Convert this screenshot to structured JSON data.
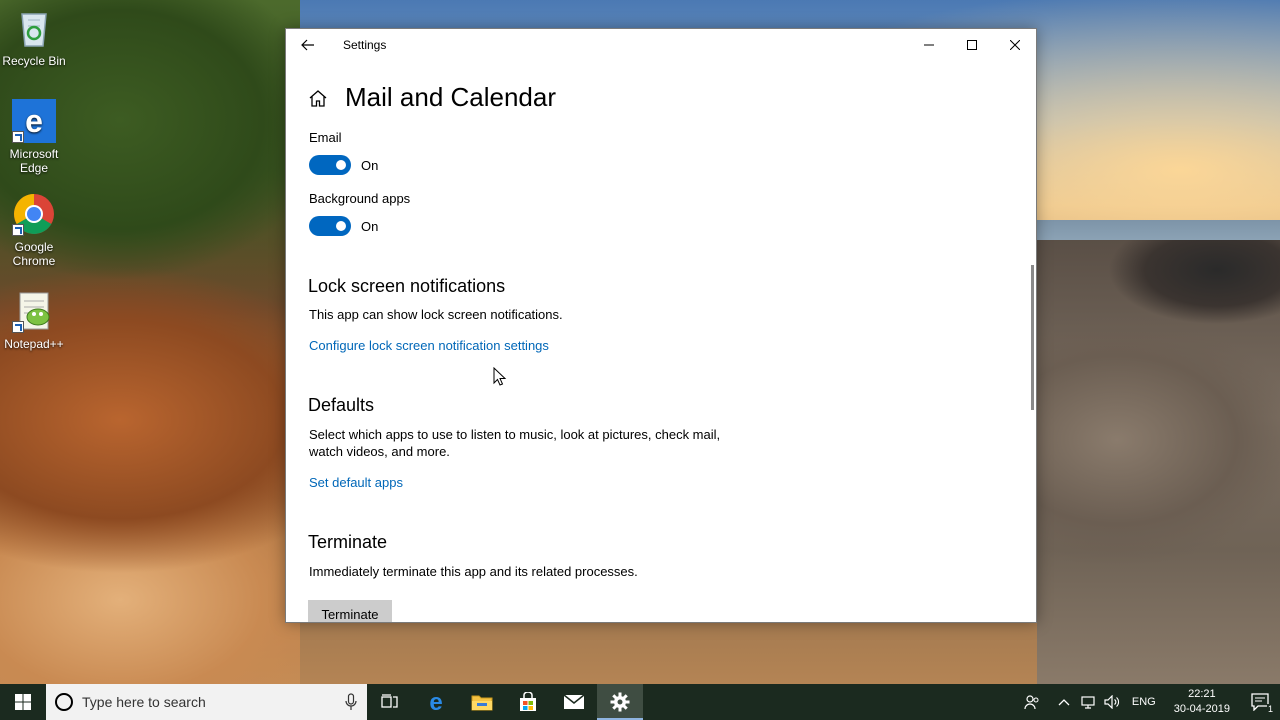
{
  "desktop": {
    "icons": [
      {
        "label": "Recycle Bin"
      },
      {
        "label": "Microsoft Edge"
      },
      {
        "label": "Google Chrome"
      },
      {
        "label": "Notepad++"
      }
    ]
  },
  "window": {
    "title": "Settings",
    "page_title": "Mail and Calendar",
    "email": {
      "label": "Email",
      "state": "On"
    },
    "background_apps": {
      "label": "Background apps",
      "state": "On"
    },
    "lock_screen": {
      "title": "Lock screen notifications",
      "description": "This app can show lock screen notifications.",
      "link": "Configure lock screen notification settings"
    },
    "defaults": {
      "title": "Defaults",
      "description_line1": "Select which apps to use to listen to music, look at pictures, check mail,",
      "description_line2": "watch videos, and more.",
      "link": "Set default apps"
    },
    "terminate": {
      "title": "Terminate",
      "description": "Immediately terminate this app and its related processes.",
      "button_label": "Terminate"
    }
  },
  "taskbar": {
    "search_placeholder": "Type here to search",
    "language": "ENG",
    "time": "22:21",
    "date": "30-04-2019",
    "notification_count": "1"
  },
  "colors": {
    "accent": "#0067c0",
    "link": "#0067b8",
    "taskbar": "#1b2a1f"
  }
}
